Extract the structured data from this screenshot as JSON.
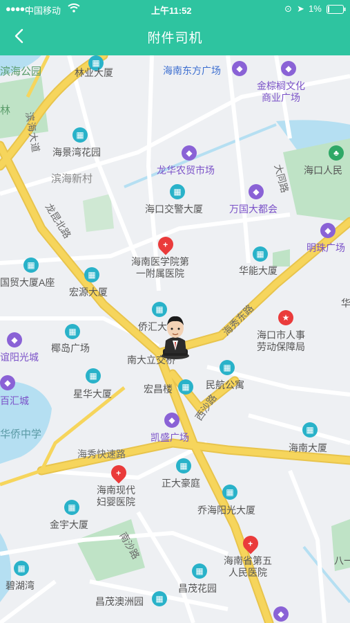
{
  "status": {
    "carrier": "中国移动",
    "time": "上午11:52",
    "battery": "1%"
  },
  "nav": {
    "title": "附件司机"
  },
  "map": {
    "roads": [
      "滨海大道",
      "龙昆北路",
      "海秀东路",
      "海秀快速路",
      "西沙路",
      "南沙路",
      "大同路"
    ],
    "areas": [
      "滨海新村",
      "滨海公园",
      "林",
      "华侨中学"
    ],
    "pois": [
      {
        "name": "林业大厦"
      },
      {
        "name": "海南东方广场"
      },
      {
        "name": "金棕榈文化\n商业广场"
      },
      {
        "name": "海景湾花园"
      },
      {
        "name": "龙华农贸市场"
      },
      {
        "name": "海口人民"
      },
      {
        "name": "海口交警大厦"
      },
      {
        "name": "万国大都会"
      },
      {
        "name": "海南医学院第\n一附属医院"
      },
      {
        "name": "明珠广场"
      },
      {
        "name": "华能大厦"
      },
      {
        "name": "国贸大厦A座"
      },
      {
        "name": "宏源大厦"
      },
      {
        "name": "侨汇大"
      },
      {
        "name": "海口市人事\n劳动保障局"
      },
      {
        "name": "椰岛广场"
      },
      {
        "name": "谊阳光城"
      },
      {
        "name": "南大立交桥"
      },
      {
        "name": "民航公寓"
      },
      {
        "name": "宏昌楼"
      },
      {
        "name": "星华大厦"
      },
      {
        "name": "百汇城"
      },
      {
        "name": "凯盛广场"
      },
      {
        "name": "海南大厦"
      },
      {
        "name": "正大豪庭"
      },
      {
        "name": "海南现代\n妇婴医院"
      },
      {
        "name": "乔海阳光大厦"
      },
      {
        "name": "金宇大厦"
      },
      {
        "name": "海南省第五\n人民医院"
      },
      {
        "name": "碧湖湾"
      },
      {
        "name": "昌茂花园"
      },
      {
        "name": "昌茂澳洲园"
      },
      {
        "name": "八一"
      },
      {
        "name": "华"
      }
    ]
  },
  "colors": {
    "accent": "#2ec4a0",
    "road": "#f6d55c",
    "water": "#b5dff2",
    "park": "#bfe3c6"
  }
}
